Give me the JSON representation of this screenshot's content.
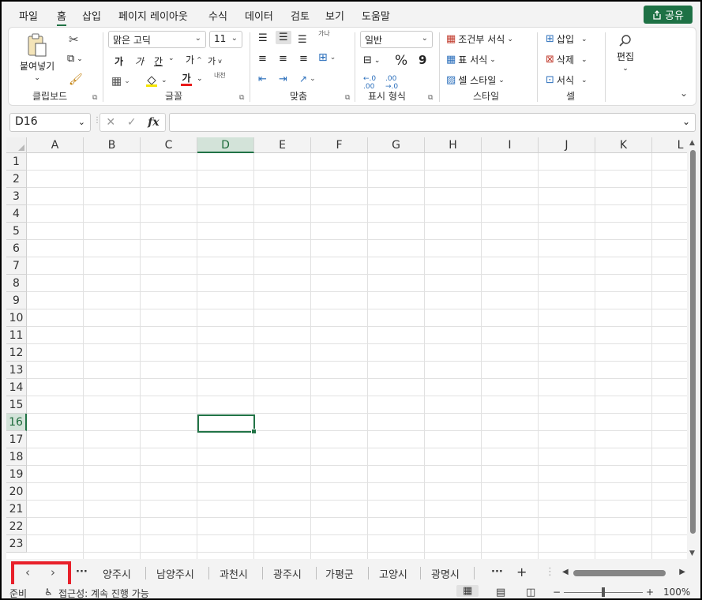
{
  "menu": {
    "tabs": [
      "파일",
      "홈",
      "삽입",
      "페이지 레이아웃",
      "수식",
      "데이터",
      "검토",
      "보기",
      "도움말"
    ],
    "active": "홈",
    "share_label": "공유"
  },
  "ribbon": {
    "clipboard": {
      "paste_label": "붙여넣기",
      "group_label": "클립보드"
    },
    "font": {
      "font_name": "맑은 고딕",
      "font_size": "11",
      "bold": "가",
      "italic": "가",
      "underline": "간",
      "grow": "가",
      "shrink": "가",
      "font_color_glyph": "가",
      "phonetic": "내천",
      "group_label": "글꼴"
    },
    "alignment": {
      "wrap_glyph": "가나",
      "group_label": "맞춤"
    },
    "number": {
      "format": "일반",
      "percent": "%",
      "comma": "9",
      "group_label": "표시 형식"
    },
    "styles": {
      "conditional": "조건부 서식",
      "table": "표 서식",
      "cell_styles": "셀 스타일",
      "group_label": "스타일"
    },
    "cells": {
      "insert": "삽입",
      "delete": "삭제",
      "format": "서식",
      "group_label": "셀"
    },
    "editing": {
      "label": "편집"
    }
  },
  "formula_bar": {
    "name_box": "D16",
    "fx": "fx",
    "content": ""
  },
  "grid": {
    "columns": [
      "A",
      "B",
      "C",
      "D",
      "E",
      "F",
      "G",
      "H",
      "I",
      "J",
      "K",
      "L"
    ],
    "rows": [
      "1",
      "2",
      "3",
      "4",
      "5",
      "6",
      "7",
      "8",
      "9",
      "10",
      "11",
      "12",
      "13",
      "14",
      "15",
      "16",
      "17",
      "18",
      "19",
      "20",
      "21",
      "22",
      "23"
    ],
    "active_column": "D",
    "active_row": "16"
  },
  "sheets": {
    "tabs": [
      "양주시",
      "남양주시",
      "과천시",
      "광주시",
      "가평군",
      "고양시",
      "광명시"
    ],
    "overflow_left": "···",
    "overflow_right": "···",
    "add": "+"
  },
  "status": {
    "ready": "준비",
    "accessibility": "접근성: 계속 진행 가능",
    "zoom": "100%",
    "zoom_minus": "−",
    "zoom_plus": "+"
  },
  "colors": {
    "accent": "#217346",
    "highlight_box": "#e8202a",
    "share_bg": "#1e7145"
  }
}
